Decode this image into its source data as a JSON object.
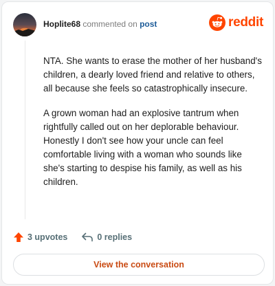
{
  "header": {
    "username": "Hoplite68",
    "action_text": "commented on",
    "post_link": "post",
    "brand_name": "reddit"
  },
  "comment": {
    "paragraphs": [
      "NTA. She wants to erase the mother of her husband's children, a dearly loved friend and relative to others, all because she feels so catastrophically insecure.",
      "A grown woman had an explosive tantrum when rightfully called out on her deplorable behaviour. Honestly I don't see how your uncle can feel comfortable living with a woman who sounds like she's starting to despise his family, as well as his children."
    ]
  },
  "actions": {
    "upvotes": "3 upvotes",
    "replies": "0 replies"
  },
  "cta": {
    "label": "View the conversation"
  },
  "icons": {
    "avatar": "avatar-image",
    "brand": "reddit-alien-icon",
    "upvote": "upvote-arrow-icon",
    "reply": "reply-arrow-icon"
  },
  "colors": {
    "brand": "#ff4500",
    "link": "#1d5c99",
    "cta_text": "#c94a12",
    "muted": "#7c7c7c"
  }
}
